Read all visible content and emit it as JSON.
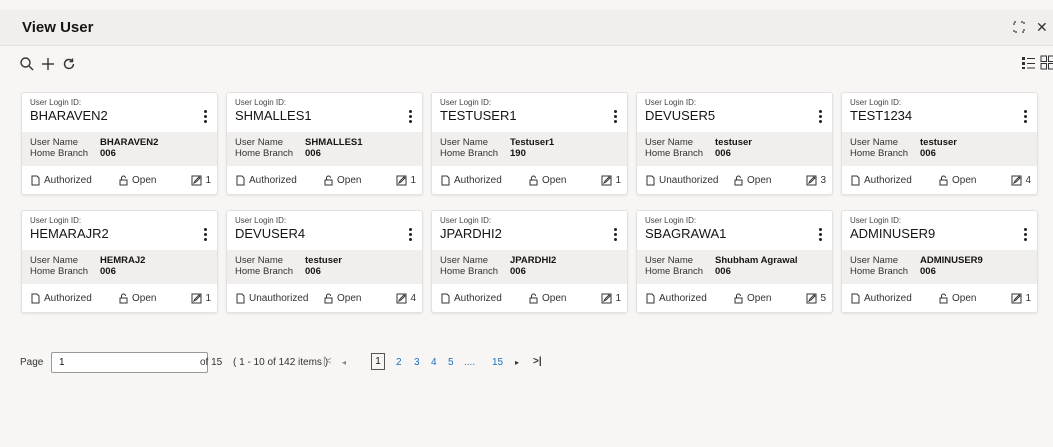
{
  "window": {
    "title": "View User",
    "restore_icon": "restore-icon",
    "close_icon": "close-icon"
  },
  "toolbar": {
    "search_icon": "search-icon",
    "add_icon": "plus-icon",
    "refresh_icon": "refresh-icon",
    "list_view_icon": "list-view-icon",
    "grid_view_icon": "grid-view-icon"
  },
  "cards": [
    {
      "login_label": "User Login ID:",
      "login": "BHARAVEN2",
      "name_label": "User Name",
      "name": "BHARAVEN2",
      "branch_label": "Home Branch",
      "branch": "006",
      "status": "Authorized",
      "lock": "Open",
      "version": "1"
    },
    {
      "login_label": "User Login ID:",
      "login": "SHMALLES1",
      "name_label": "User Name",
      "name": "SHMALLES1",
      "branch_label": "Home Branch",
      "branch": "006",
      "status": "Authorized",
      "lock": "Open",
      "version": "1"
    },
    {
      "login_label": "User Login ID:",
      "login": "TESTUSER1",
      "name_label": "User Name",
      "name": "Testuser1",
      "branch_label": "Home Branch",
      "branch": "190",
      "status": "Authorized",
      "lock": "Open",
      "version": "1"
    },
    {
      "login_label": "User Login ID:",
      "login": "DEVUSER5",
      "name_label": "User Name",
      "name": "testuser",
      "branch_label": "Home Branch",
      "branch": "006",
      "status": "Unauthorized",
      "lock": "Open",
      "version": "3"
    },
    {
      "login_label": "User Login ID:",
      "login": "TEST1234",
      "name_label": "User Name",
      "name": "testuser",
      "branch_label": "Home Branch",
      "branch": "006",
      "status": "Authorized",
      "lock": "Open",
      "version": "4"
    },
    {
      "login_label": "User Login ID:",
      "login": "HEMARAJR2",
      "name_label": "User Name",
      "name": "HEMRAJ2",
      "branch_label": "Home Branch",
      "branch": "006",
      "status": "Authorized",
      "lock": "Open",
      "version": "1"
    },
    {
      "login_label": "User Login ID:",
      "login": "DEVUSER4",
      "name_label": "User Name",
      "name": "testuser",
      "branch_label": "Home Branch",
      "branch": "006",
      "status": "Unauthorized",
      "lock": "Open",
      "version": "4"
    },
    {
      "login_label": "User Login ID:",
      "login": "JPARDHI2",
      "name_label": "User Name",
      "name": "JPARDHI2",
      "branch_label": "Home Branch",
      "branch": "006",
      "status": "Authorized",
      "lock": "Open",
      "version": "1"
    },
    {
      "login_label": "User Login ID:",
      "login": "SBAGRAWA1",
      "name_label": "User Name",
      "name": "Shubham Agrawal",
      "branch_label": "Home Branch",
      "branch": "006",
      "status": "Authorized",
      "lock": "Open",
      "version": "5"
    },
    {
      "login_label": "User Login ID:",
      "login": "ADMINUSER9",
      "name_label": "User Name",
      "name": "ADMINUSER9",
      "branch_label": "Home Branch",
      "branch": "006",
      "status": "Authorized",
      "lock": "Open",
      "version": "1"
    }
  ],
  "pagination": {
    "page_label": "Page",
    "page_value": "1",
    "of_text": "of 15",
    "items_text": "( 1 - 10 of 142 items )",
    "first_icon": "|<",
    "prev_icon": "◂",
    "current": "1",
    "pages": [
      "2",
      "3",
      "4",
      "5",
      "....",
      "15"
    ],
    "next_icon": "▸",
    "last_icon": ">|"
  }
}
